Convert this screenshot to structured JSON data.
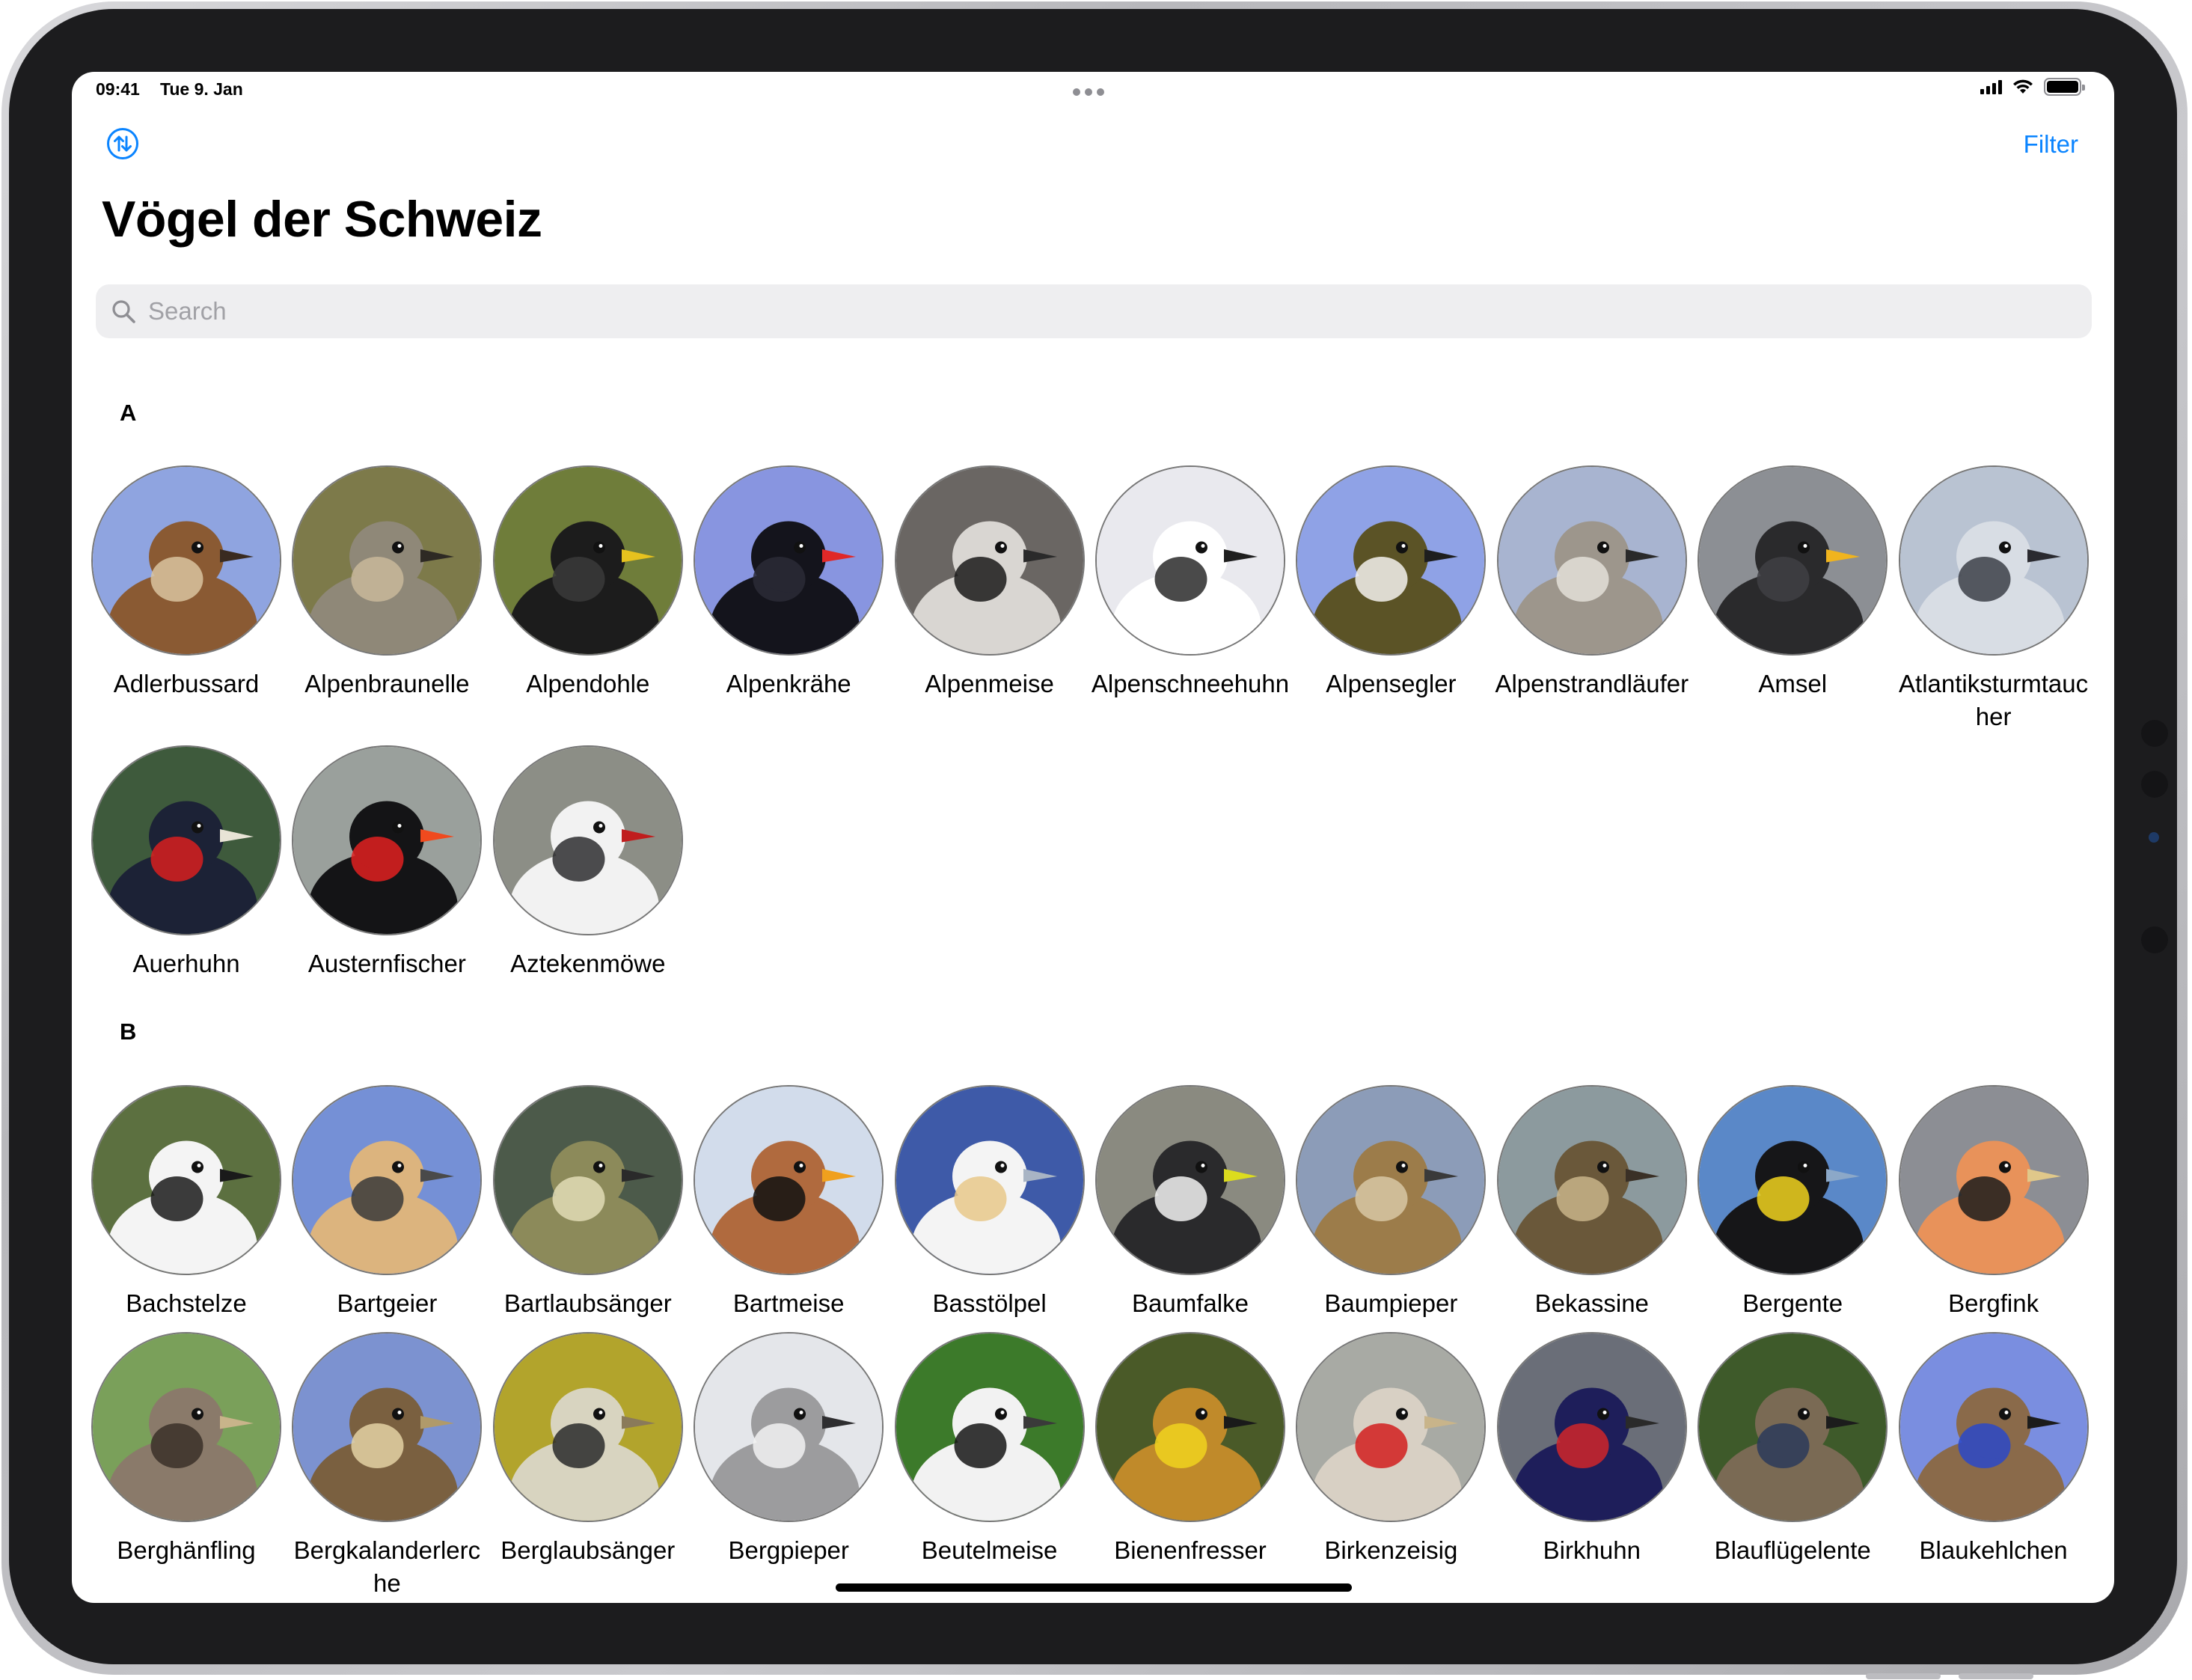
{
  "status_bar": {
    "time": "09:41",
    "date": "Tue 9. Jan"
  },
  "nav": {
    "sort_icon": "arrow-up-down-circle-icon",
    "filter_label": "Filter"
  },
  "title": "Vögel der Schweiz",
  "search": {
    "placeholder": "Search",
    "value": ""
  },
  "colors": {
    "accent": "#0a84ff",
    "search_background": "#eeeef0"
  },
  "sections": [
    {
      "letter": "A",
      "birds": [
        {
          "name": "Adlerbussard",
          "colors": {
            "bg": "#8fa4e0",
            "body": "#8a5a33",
            "beak": "#3a2b20",
            "accent": "#d9c4a0"
          }
        },
        {
          "name": "Alpenbraunelle",
          "colors": {
            "bg": "#7d7a4a",
            "body": "#8f8878",
            "beak": "#2e2a24",
            "accent": "#c9b89a"
          }
        },
        {
          "name": "Alpendohle",
          "colors": {
            "bg": "#6f7d3a",
            "body": "#1c1c1c",
            "beak": "#e6c21e",
            "accent": "#3a3a3a"
          }
        },
        {
          "name": "Alpenkrähe",
          "colors": {
            "bg": "#8895e0",
            "body": "#14141c",
            "beak": "#e02828",
            "accent": "#2a2a36"
          }
        },
        {
          "name": "Alpenmeise",
          "colors": {
            "bg": "#6a6663",
            "body": "#d9d6d2",
            "beak": "#2a2a2a",
            "accent": "#1a1a1a"
          }
        },
        {
          "name": "Alpenschneehuhn",
          "colors": {
            "bg": "#e9e9ee",
            "body": "#ffffff",
            "beak": "#1e1e1e",
            "accent": "#2a2a2a"
          }
        },
        {
          "name": "Alpensegler",
          "colors": {
            "bg": "#8fa2e6",
            "body": "#5b5326",
            "beak": "#1e1e1e",
            "accent": "#f4f2ee"
          }
        },
        {
          "name": "Alpenstrandläufer",
          "colors": {
            "bg": "#a8b4d0",
            "body": "#9d968c",
            "beak": "#2a2a2a",
            "accent": "#e4e0d8"
          }
        },
        {
          "name": "Amsel",
          "colors": {
            "bg": "#8c8f94",
            "body": "#2a2a2c",
            "beak": "#f0b41e",
            "accent": "#404044"
          }
        },
        {
          "name": "Atlantiksturmtaucher",
          "colors": {
            "bg": "#b9c3d2",
            "body": "#d8dde4",
            "beak": "#2a2a30",
            "accent": "#3c4048"
          }
        }
      ]
    },
    {
      "letter": "",
      "birds": [
        {
          "name": "Auerhuhn",
          "colors": {
            "bg": "#3e5a3c",
            "body": "#1c2236",
            "beak": "#e8e4d6",
            "accent": "#d81e1e"
          }
        },
        {
          "name": "Austernfischer",
          "colors": {
            "bg": "#9aa09c",
            "body": "#141416",
            "beak": "#f04a1e",
            "accent": "#e02020"
          }
        },
        {
          "name": "Aztekenmöwe",
          "colors": {
            "bg": "#8c8e86",
            "body": "#f2f2f2",
            "beak": "#c01e1e",
            "accent": "#2e2e30"
          }
        }
      ]
    },
    {
      "letter": "B",
      "birds": [
        {
          "name": "Bachstelze",
          "colors": {
            "bg": "#5c7040",
            "body": "#f4f4f4",
            "beak": "#1a1a1a",
            "accent": "#1a1a1a"
          }
        },
        {
          "name": "Bartgeier",
          "colors": {
            "bg": "#7590d6",
            "body": "#dcb47e",
            "beak": "#4a4a4a",
            "accent": "#3a3a3a"
          }
        },
        {
          "name": "Bartlaubsänger",
          "colors": {
            "bg": "#4c5a4a",
            "body": "#8c8a5a",
            "beak": "#2a2a2a",
            "accent": "#e2dcb6"
          }
        },
        {
          "name": "Bartmeise",
          "colors": {
            "bg": "#d2dceb",
            "body": "#b06a3e",
            "beak": "#f0a01e",
            "accent": "#101010"
          }
        },
        {
          "name": "Basstölpel",
          "colors": {
            "bg": "#3e5aa8",
            "body": "#f4f4f4",
            "beak": "#a8b4c4",
            "accent": "#e8c88a"
          }
        },
        {
          "name": "Baumfalke",
          "colors": {
            "bg": "#8a8a80",
            "body": "#2a2a2c",
            "beak": "#dcdc1e",
            "accent": "#f2f2f2"
          }
        },
        {
          "name": "Baumpieper",
          "colors": {
            "bg": "#8c9cb8",
            "body": "#9c7c4a",
            "beak": "#3a3a3a",
            "accent": "#d8c8a4"
          }
        },
        {
          "name": "Bekassine",
          "colors": {
            "bg": "#8c9a9e",
            "body": "#6a583a",
            "beak": "#3a3026",
            "accent": "#c8b48a"
          }
        },
        {
          "name": "Bergente",
          "colors": {
            "bg": "#5a88c8",
            "body": "#161618",
            "beak": "#8ca8c8",
            "accent": "#f0d21e"
          }
        },
        {
          "name": "Bergfink",
          "colors": {
            "bg": "#8c8e94",
            "body": "#e8925a",
            "beak": "#e0c88a",
            "accent": "#1c1c1c"
          }
        }
      ]
    },
    {
      "letter": "",
      "birds": [
        {
          "name": "Berghänfling",
          "colors": {
            "bg": "#7aa05a",
            "body": "#8a7a6a",
            "beak": "#c8b48a",
            "accent": "#3a3028"
          }
        },
        {
          "name": "Bergkalanderlerche",
          "colors": {
            "bg": "#7c92d0",
            "body": "#7a6040",
            "beak": "#b09a6a",
            "accent": "#e4d2a4"
          }
        },
        {
          "name": "Berglaubsänger",
          "colors": {
            "bg": "#b2a42c",
            "body": "#d8d4c0",
            "beak": "#8a7a5a",
            "accent": "#2a2a2a"
          }
        },
        {
          "name": "Bergpieper",
          "colors": {
            "bg": "#e4e6ea",
            "body": "#9c9c9e",
            "beak": "#2e2e30",
            "accent": "#f2f2f2"
          }
        },
        {
          "name": "Beutelmeise",
          "colors": {
            "bg": "#3c7a2a",
            "body": "#f2f2f2",
            "beak": "#3a3a3a",
            "accent": "#161616"
          }
        },
        {
          "name": "Bienenfresser",
          "colors": {
            "bg": "#4a5a28",
            "body": "#c08a2a",
            "beak": "#1a1a1a",
            "accent": "#f0d21e"
          }
        },
        {
          "name": "Birkenzeisig",
          "colors": {
            "bg": "#a8aaa4",
            "body": "#d8d0c4",
            "beak": "#c8b48a",
            "accent": "#d21e1e"
          }
        },
        {
          "name": "Birkhuhn",
          "colors": {
            "bg": "#6a6e78",
            "body": "#1e1e5a",
            "beak": "#2a2a2a",
            "accent": "#d0262a"
          }
        },
        {
          "name": "Blauflügelente",
          "colors": {
            "bg": "#3e5a2a",
            "body": "#7a6a54",
            "beak": "#1c1c1c",
            "accent": "#2c3a5a"
          }
        },
        {
          "name": "Blaukehlchen",
          "colors": {
            "bg": "#7a8ee0",
            "body": "#8a6a4a",
            "beak": "#1c1c1c",
            "accent": "#2a48c8"
          }
        }
      ]
    }
  ]
}
